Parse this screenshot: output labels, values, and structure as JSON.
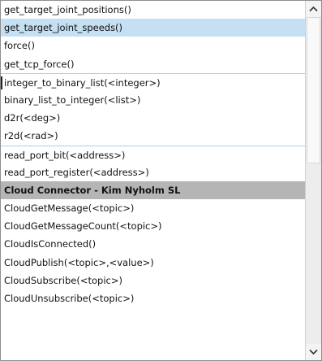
{
  "dropdown": {
    "items": [
      {
        "label": "get_target_joint_positions()"
      },
      {
        "label": "get_target_joint_speeds()",
        "state": "selected"
      },
      {
        "label": "force()"
      },
      {
        "label": "get_tcp_force()"
      },
      {
        "label": "integer_to_binary_list(<integer>)"
      },
      {
        "label": "binary_list_to_integer(<list>)"
      },
      {
        "label": "d2r(<deg>)"
      },
      {
        "label": "r2d(<rad>)"
      },
      {
        "label": "read_port_bit(<address>)"
      },
      {
        "label": "read_port_register(<address>)"
      },
      {
        "label": "Cloud Connector - Kim Nyholm SL",
        "state": "header"
      },
      {
        "label": "CloudGetMessage(<topic>)"
      },
      {
        "label": "CloudGetMessageCount(<topic>)"
      },
      {
        "label": "CloudIsConnected()"
      },
      {
        "label": "CloudPublish(<topic>,<value>)"
      },
      {
        "label": "CloudSubscribe(<topic>)"
      },
      {
        "label": "CloudUnsubscribe(<topic>)"
      }
    ]
  },
  "scrollbar": {
    "up_icon": "chevron-up-icon",
    "down_icon": "chevron-down-icon"
  },
  "colors": {
    "selected_bg": "#c5dff3",
    "header_bg": "#b5b5b5",
    "separator": "#a9d0e8"
  }
}
